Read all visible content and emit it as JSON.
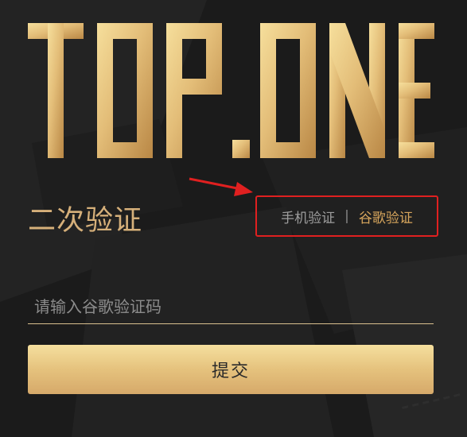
{
  "brand": {
    "logo_text": "TOP.ONE"
  },
  "page": {
    "title": "二次验证"
  },
  "switcher": {
    "phone_label": "手机验证",
    "separator": "|",
    "google_label": "谷歌验证"
  },
  "form": {
    "code_placeholder": "请输入谷歌验证码",
    "code_value": "",
    "submit_label": "提交"
  },
  "colors": {
    "accent_gold": "#d6b07a",
    "annotation_red": "#e02020",
    "background": "#1a1a1a"
  }
}
